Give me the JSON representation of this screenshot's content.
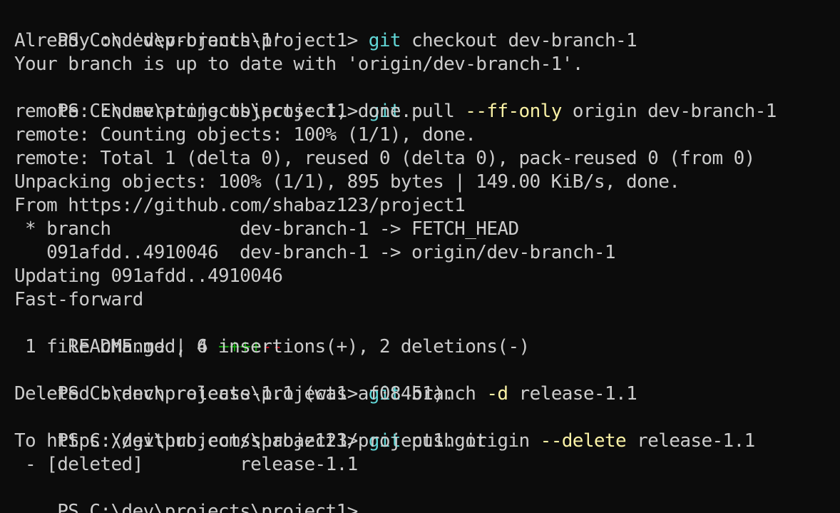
{
  "prompt": "PS C:\\dev\\projects\\project1> ",
  "commands": {
    "c1": {
      "cmd": "git",
      "rest": " checkout dev-branch-1"
    },
    "c2": {
      "cmd": "git",
      "rest1": " pull ",
      "flag": "--ff-only",
      "rest2": " origin dev-branch-1"
    },
    "c3": {
      "cmd": "git",
      "rest1": " branch ",
      "flag": "-d",
      "rest2": " release-1.1"
    },
    "c4": {
      "cmd": "git",
      "rest1": " push origin ",
      "flag": "--delete",
      "rest2": " release-1.1"
    }
  },
  "output": {
    "o1": "Already on 'dev-branch-1'",
    "o2": "Your branch is up to date with 'origin/dev-branch-1'.",
    "o3": "remote: Enumerating objects: 1, done.",
    "o4": "remote: Counting objects: 100% (1/1), done.",
    "o5": "remote: Total 1 (delta 0), reused 0 (delta 0), pack-reused 0 (from 0)",
    "o6": "Unpacking objects: 100% (1/1), 895 bytes | 149.00 KiB/s, done.",
    "o7": "From https://github.com/shabaz123/project1",
    "o8": " * branch            dev-branch-1 -> FETCH_HEAD",
    "o9": "   091afdd..4910046  dev-branch-1 -> origin/dev-branch-1",
    "o10": "Updating 091afdd..4910046",
    "o11": "Fast-forward",
    "o12_text": " README.md | 6 ",
    "o12_add": "++++",
    "o12_del": "--",
    "o13": " 1 file changed, 4 insertions(+), 2 deletions(-)",
    "o14": "Deleted branch release-1.1 (was af08451).",
    "o15": "To https://github.com/shabaz123/project1.git",
    "o16": " - [deleted]         release-1.1"
  },
  "colors": {
    "background": "#0c0c0c",
    "foreground": "#cccccc",
    "command": "#61d6d6",
    "flag": "#f9f1a5",
    "insertions": "#13a10e",
    "deletions": "#c50f1f"
  }
}
